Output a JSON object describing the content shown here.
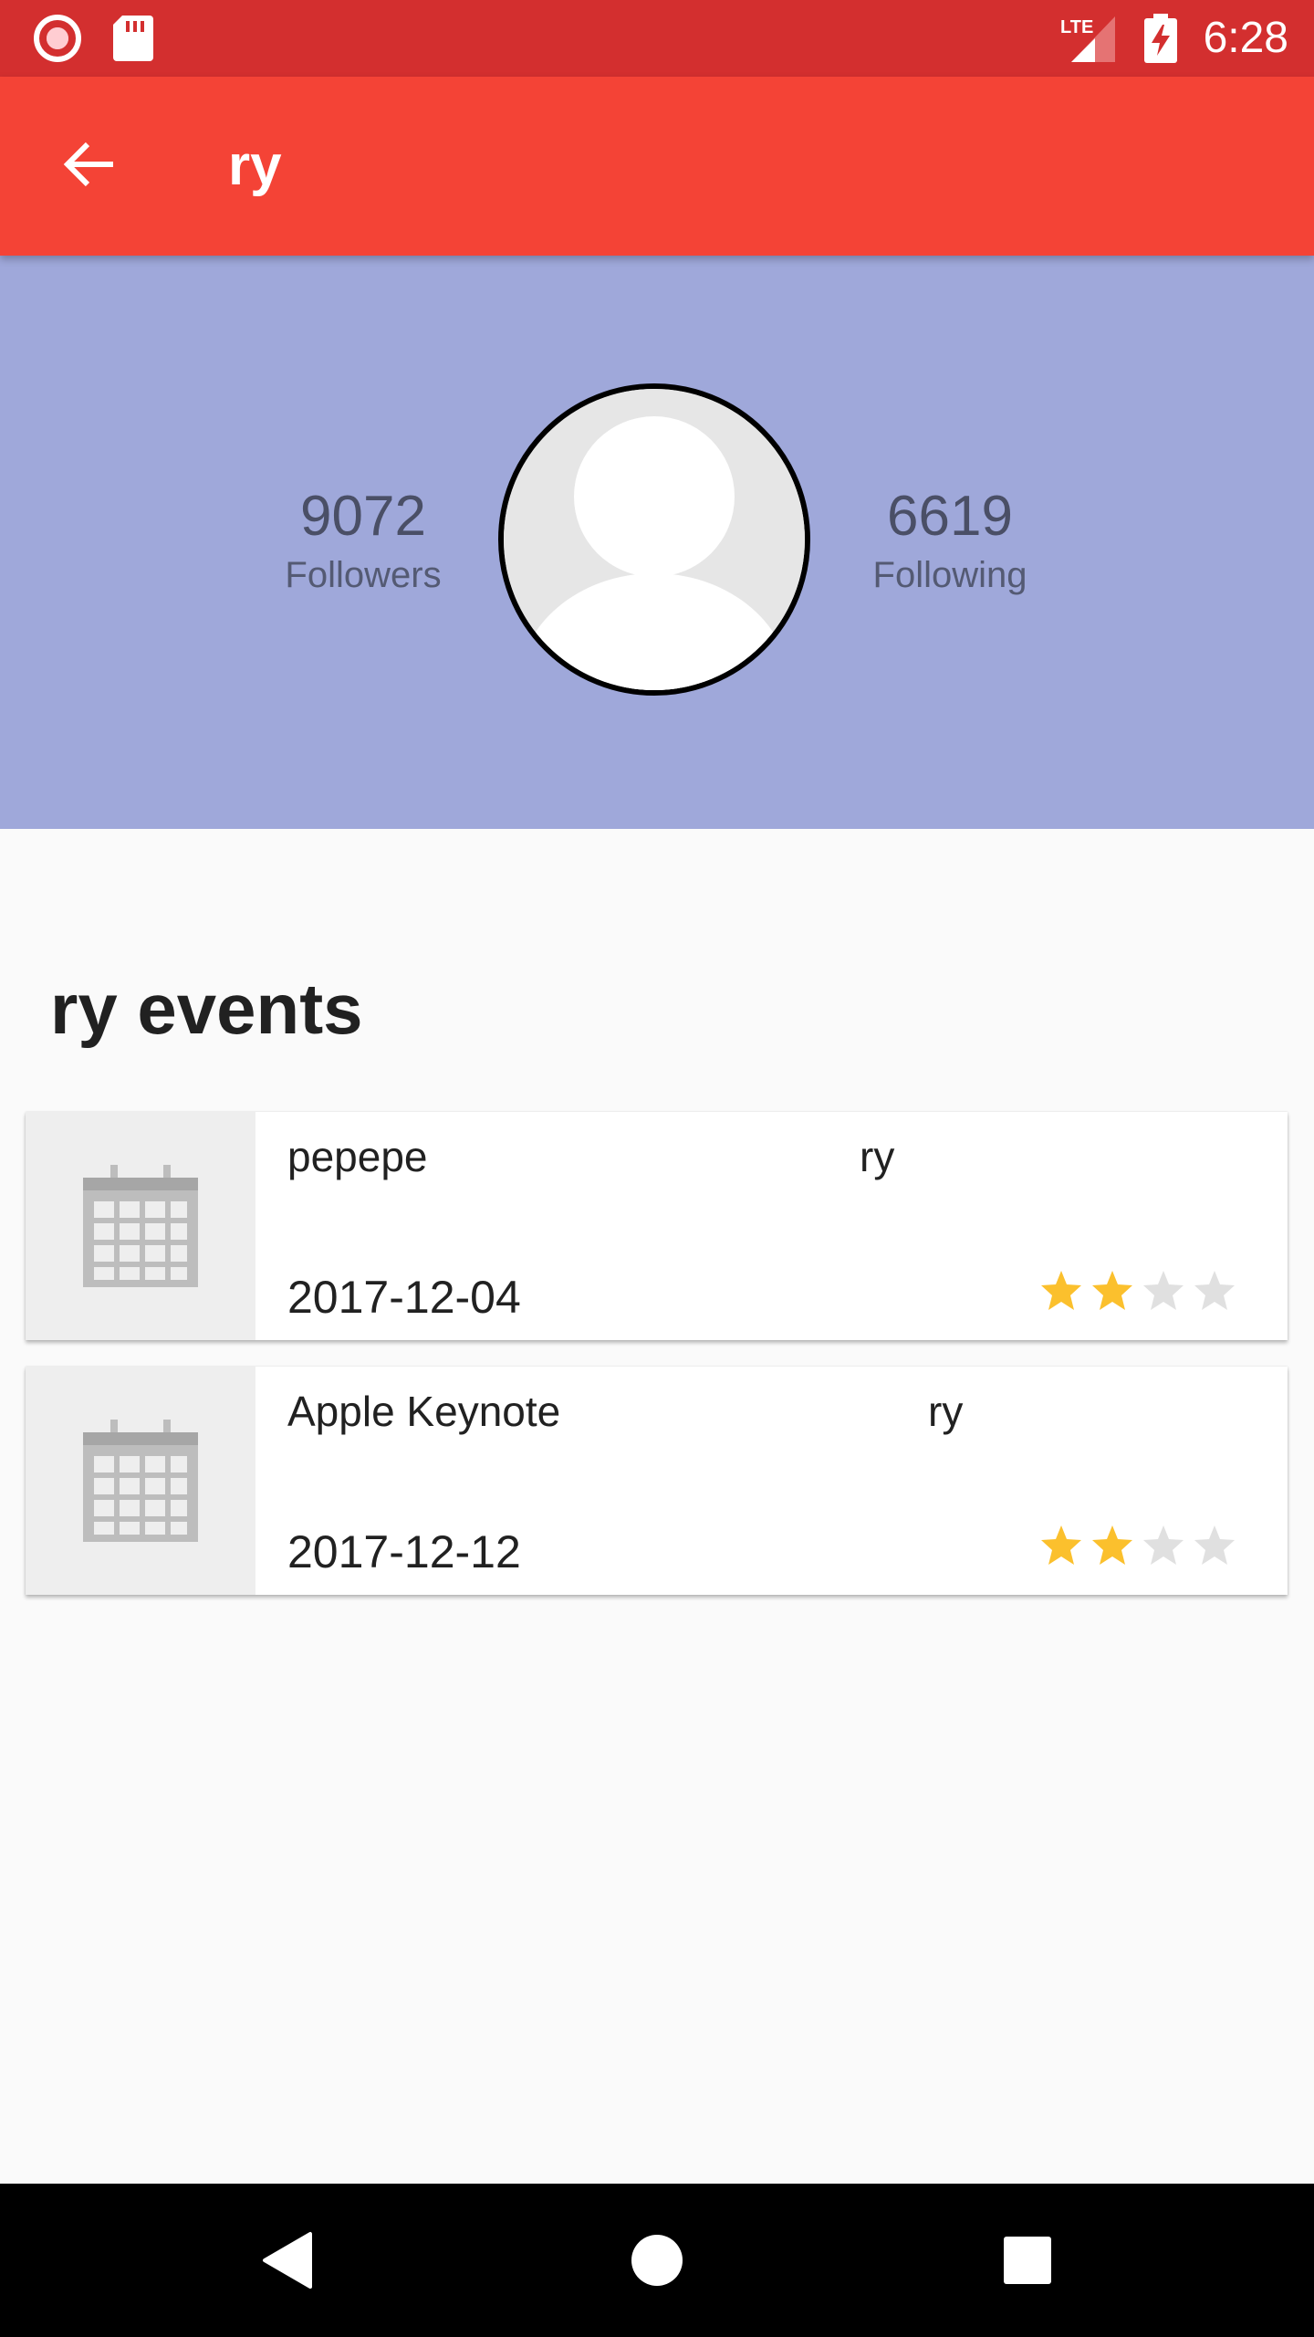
{
  "status_bar": {
    "time": "6:28",
    "network": "LTE"
  },
  "app_bar": {
    "title": "ry",
    "back_icon": "arrow-left-icon"
  },
  "profile": {
    "followers_count": "9072",
    "followers_label": "Followers",
    "following_count": "6619",
    "following_label": "Following"
  },
  "events_title": "ry events",
  "events": [
    {
      "name": "pepepe",
      "owner": "ry",
      "date": "2017-12-04",
      "rating": 2,
      "max_rating": 4
    },
    {
      "name": "Apple Keynote",
      "owner": "ry",
      "date": "2017-12-12",
      "rating": 2,
      "max_rating": 4
    }
  ],
  "colors": {
    "status_bar": "#d32f2f",
    "app_bar": "#f44336",
    "profile_bg": "#9fa8da",
    "star_filled": "#fbc02d",
    "star_empty": "#e0e0e0"
  }
}
